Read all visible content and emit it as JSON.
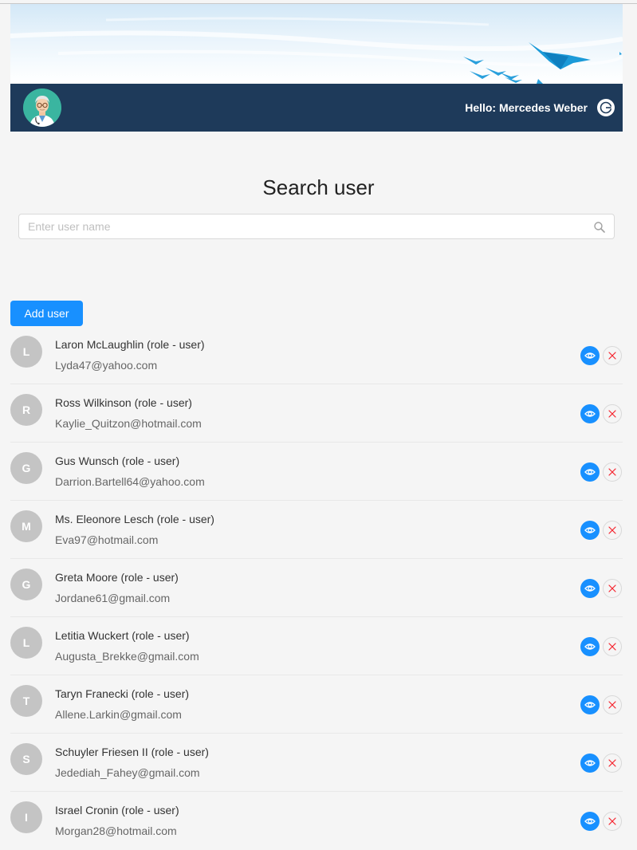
{
  "header": {
    "greeting": "Hello: Mercedes Weber"
  },
  "search": {
    "title": "Search user",
    "placeholder": "Enter user name",
    "value": ""
  },
  "toolbar": {
    "add_user_label": "Add user"
  },
  "users": [
    {
      "initial": "L",
      "name": "Laron McLaughlin (role - user)",
      "email": "Lyda47@yahoo.com"
    },
    {
      "initial": "R",
      "name": "Ross Wilkinson (role - user)",
      "email": "Kaylie_Quitzon@hotmail.com"
    },
    {
      "initial": "G",
      "name": "Gus Wunsch (role - user)",
      "email": "Darrion.Bartell64@yahoo.com"
    },
    {
      "initial": "M",
      "name": "Ms. Eleonore Lesch (role - user)",
      "email": "Eva97@hotmail.com"
    },
    {
      "initial": "G",
      "name": "Greta Moore (role - user)",
      "email": "Jordane61@gmail.com"
    },
    {
      "initial": "L",
      "name": "Letitia Wuckert (role - user)",
      "email": "Augusta_Brekke@gmail.com"
    },
    {
      "initial": "T",
      "name": "Taryn Franecki (role - user)",
      "email": "Allene.Larkin@gmail.com"
    },
    {
      "initial": "S",
      "name": "Schuyler Friesen II (role - user)",
      "email": "Jedediah_Fahey@gmail.com"
    },
    {
      "initial": "I",
      "name": "Israel Cronin (role - user)",
      "email": "Morgan28@hotmail.com"
    }
  ],
  "icons": {
    "view": "eye-icon",
    "delete": "close-icon",
    "search": "search-icon",
    "logout": "logout-icon",
    "avatar": "doctor-avatar-icon"
  },
  "colors": {
    "primary": "#1890ff",
    "header_bar": "#1e3a5a",
    "avatar_placeholder": "#c4c4c4",
    "delete_icon": "#f5222d"
  }
}
